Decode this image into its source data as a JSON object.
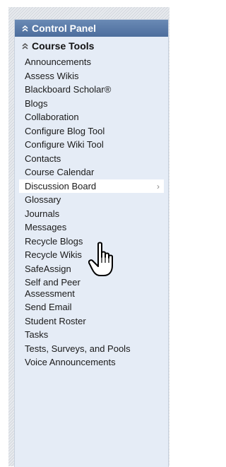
{
  "control_panel": {
    "title": "Control Panel"
  },
  "course_tools": {
    "title": "Course Tools",
    "items": [
      {
        "label": "Announcements"
      },
      {
        "label": "Assess Wikis"
      },
      {
        "label": "Blackboard Scholar®"
      },
      {
        "label": "Blogs"
      },
      {
        "label": "Collaboration"
      },
      {
        "label": "Configure Blog Tool"
      },
      {
        "label": "Configure Wiki Tool"
      },
      {
        "label": "Contacts"
      },
      {
        "label": "Course Calendar"
      },
      {
        "label": "Discussion Board",
        "has_submenu_arrow": "›"
      },
      {
        "label": "Glossary"
      },
      {
        "label": "Journals"
      },
      {
        "label": "Messages"
      },
      {
        "label": "Recycle Blogs"
      },
      {
        "label": "Recycle Wikis"
      },
      {
        "label": "SafeAssign"
      },
      {
        "label": "Self and Peer Assessment"
      },
      {
        "label": "Send Email"
      },
      {
        "label": "Student Roster"
      },
      {
        "label": "Tasks"
      },
      {
        "label": "Tests, Surveys, and Pools"
      },
      {
        "label": "Voice Announcements"
      }
    ]
  },
  "icons": {
    "collapse": "chevron-up-icon",
    "pointer": "hand-pointer-icon"
  },
  "colors": {
    "header_bg": "#5a7aa8",
    "panel_bg": "#e5ecf6",
    "active_bg": "#ffffff"
  }
}
